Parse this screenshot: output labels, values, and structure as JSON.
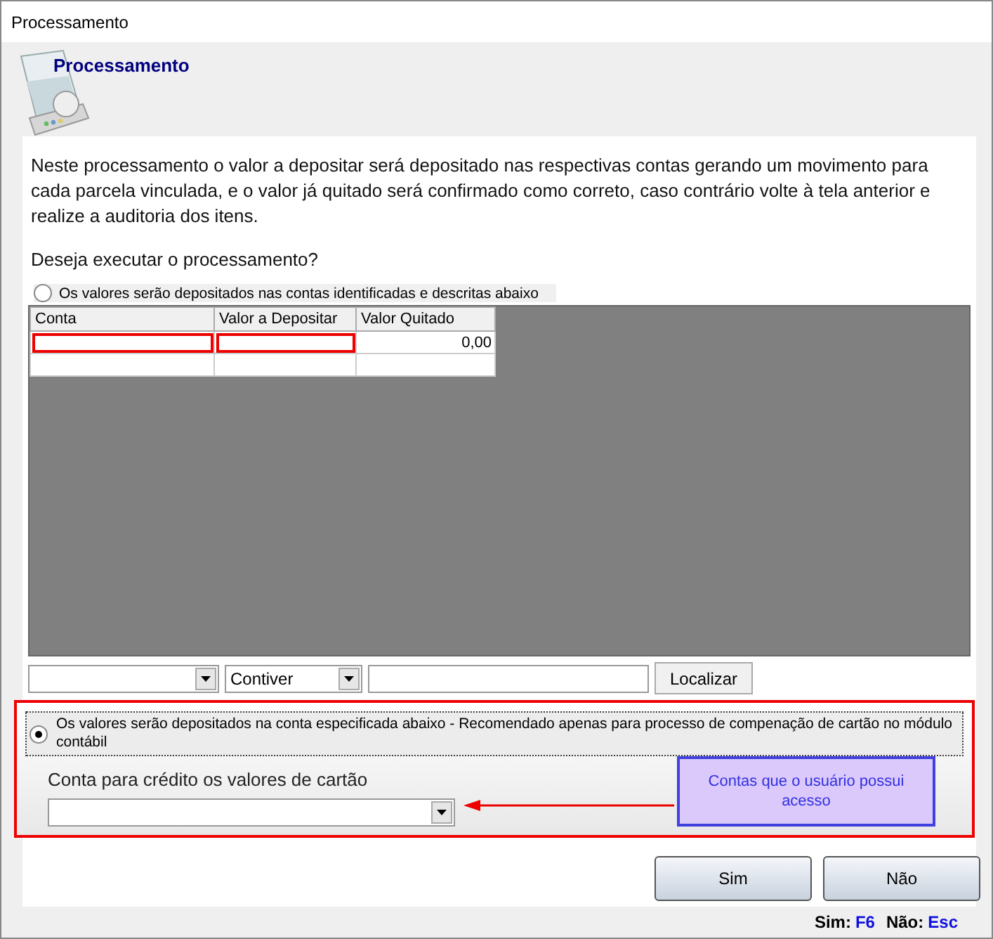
{
  "window": {
    "title": "Processamento"
  },
  "header": {
    "title": "Processamento"
  },
  "description": "Neste processamento o valor a depositar será depositado nas respectivas contas gerando um movimento para cada parcela vinculada, e o valor já quitado será confirmado como correto, caso contrário volte à tela anterior e realize a auditoria dos itens.",
  "question": "Deseja executar o processamento?",
  "option_1": {
    "label": "Os valores serão depositados nas contas identificadas e descritas abaixo",
    "selected": false
  },
  "table": {
    "columns": [
      "Conta",
      "Valor a Depositar",
      "Valor Quitado"
    ],
    "rows": [
      {
        "cells": [
          {
            "highlighted": true
          },
          {
            "highlighted": true
          },
          {
            "value": "0,00",
            "highlighted": false
          }
        ]
      },
      {
        "cells": [
          {
            "highlighted": false
          },
          {
            "highlighted": false
          },
          {
            "highlighted": false
          }
        ]
      }
    ]
  },
  "filter": {
    "condition": "Contiver",
    "button": "Localizar"
  },
  "option_2": {
    "label": "Os valores serão depositados na conta especificada abaixo - Recomendado apenas para processo de compenação de cartão no módulo contábil",
    "selected": true,
    "highlighted": true
  },
  "account": {
    "label": "Conta para crédito os valores de cartão"
  },
  "callout": "Contas que o usuário possui acesso",
  "buttons": [
    "Sim",
    "Não"
  ],
  "shortcuts": [
    {
      "label": "Sim:",
      "key": "F6"
    },
    {
      "label": "Não:",
      "key": "Esc"
    }
  ]
}
